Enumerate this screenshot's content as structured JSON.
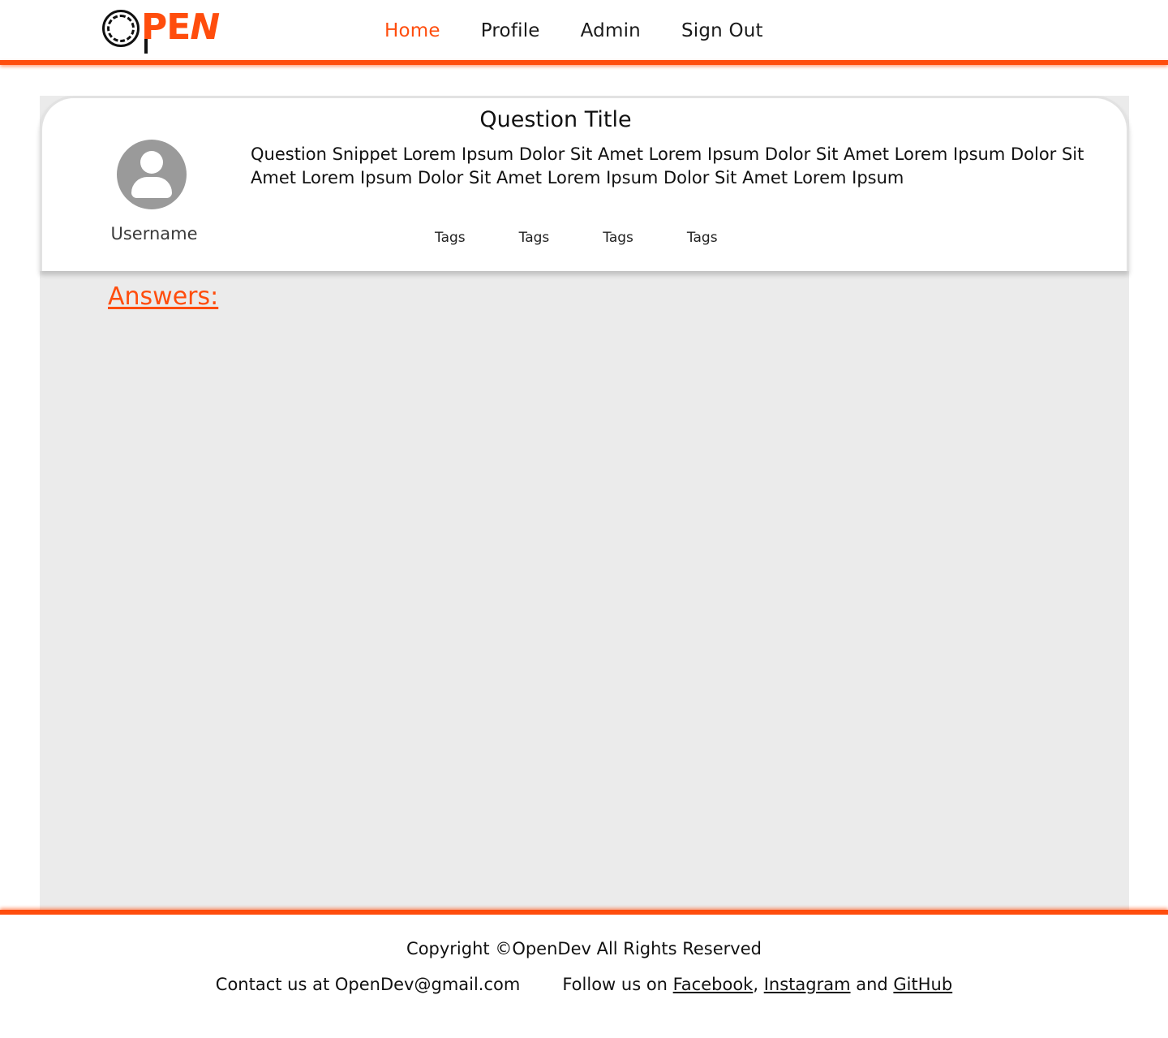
{
  "header": {
    "logo_text": "OPEN",
    "nav": {
      "home": "Home",
      "profile": "Profile",
      "admin": "Admin",
      "sign_out": "Sign Out"
    }
  },
  "question": {
    "title": "Question Title",
    "snippet": "Question Snippet Lorem Ipsum Dolor Sit Amet Lorem Ipsum Dolor Sit Amet Lorem Ipsum Dolor Sit Amet Lorem Ipsum Dolor Sit Amet Lorem Ipsum Dolor Sit Amet Lorem Ipsum",
    "username": "Username",
    "tags": [
      "Tags",
      "Tags",
      "Tags",
      "Tags"
    ]
  },
  "answers": {
    "heading": "Answers:"
  },
  "footer": {
    "copyright": "Copyright ©OpenDev All Rights Reserved",
    "contact": "Contact us at OpenDev@gmail.com",
    "follow_prefix": "Follow us on ",
    "facebook": "Facebook",
    "comma": ", ",
    "instagram": "Instagram",
    "and": " and ",
    "github": "GitHub"
  },
  "colors": {
    "accent": "#ff4d0d",
    "panel": "#ebebeb",
    "avatar": "#9a9a9a"
  },
  "icons": {
    "logo": "open-logo-icon",
    "avatar": "user-avatar-icon"
  }
}
